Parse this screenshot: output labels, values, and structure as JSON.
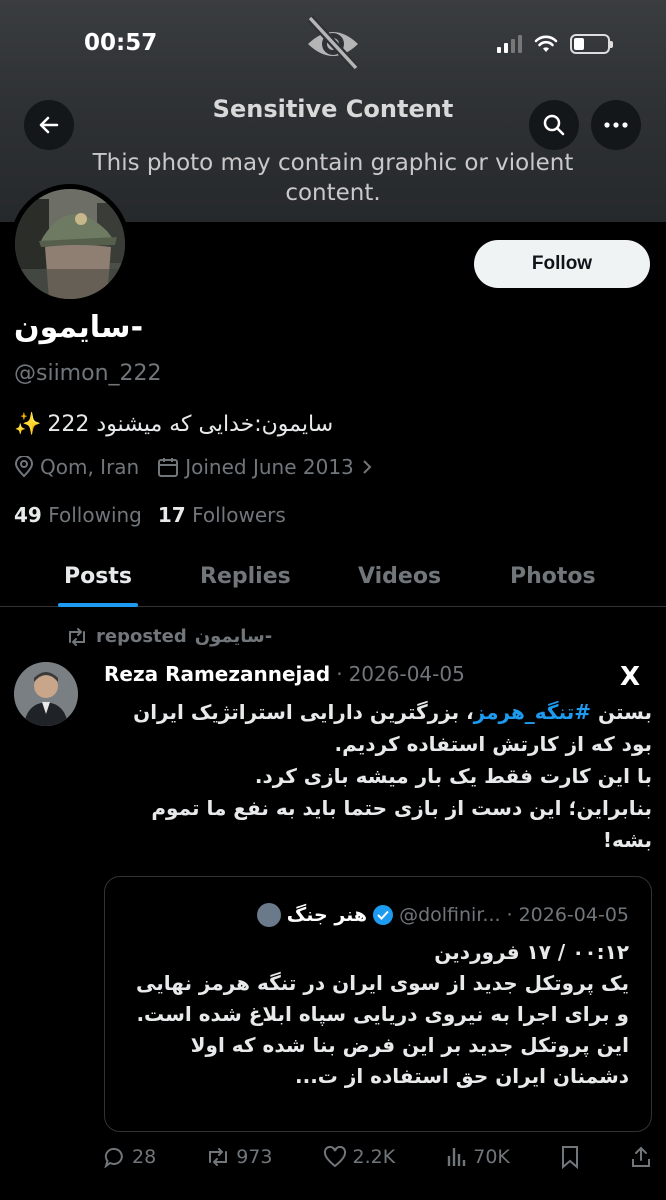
{
  "status": {
    "time": "00:57"
  },
  "banner": {
    "title": "Sensitive Content",
    "subtitle": "This photo may contain graphic or violent content."
  },
  "profile": {
    "follow_label": "Follow",
    "display_name": "سایمون-",
    "handle": "@siimon_222",
    "bio": "سایمون:خدایی که میشنود 222",
    "bio_emoji": "✨",
    "location": "Qom, Iran",
    "joined": "Joined June 2013",
    "following_count": "49",
    "following_label": "Following",
    "followers_count": "17",
    "followers_label": "Followers"
  },
  "tabs": [
    {
      "label": "Posts"
    },
    {
      "label": "Replies"
    },
    {
      "label": "Videos"
    },
    {
      "label": "Photos"
    }
  ],
  "post": {
    "repost_label": "reposted",
    "repost_by": "سایمون-",
    "author": "Reza Ramezannejad",
    "separator": "·",
    "date": "2026-04-05",
    "platform_logo": "X",
    "text_prefix": "بستن ",
    "hashtag": "#تنگه_هرمز",
    "text_line1_rest": "، بزرگترین دارایی استراتژیک ایران بود که از کارتش استفاده کردیم.",
    "text_line2": "با این کارت فقط یک بار میشه بازی کرد.",
    "text_line3": "بنابراین؛ این دست از بازی حتما باید به نفع ما تموم بشه!",
    "quote": {
      "name": "هنر جنگ",
      "handle": "@dolfinir...",
      "separator": "·",
      "date": "2026-04-05",
      "line1": "۰۰:۱۲ / ۱۷ فروردین",
      "line2": "یک پروتکل جدید از سوی ایران در تنگه هرمز نهایی و برای اجرا به نیروی دریایی سپاه ابلاغ شده است. این پروتکل جدید بر این فرض بنا شده که اولا دشمنان ایران حق استفاده از ت..."
    },
    "actions": {
      "replies": "28",
      "reposts": "973",
      "likes": "2.2K",
      "views": "70K"
    }
  }
}
